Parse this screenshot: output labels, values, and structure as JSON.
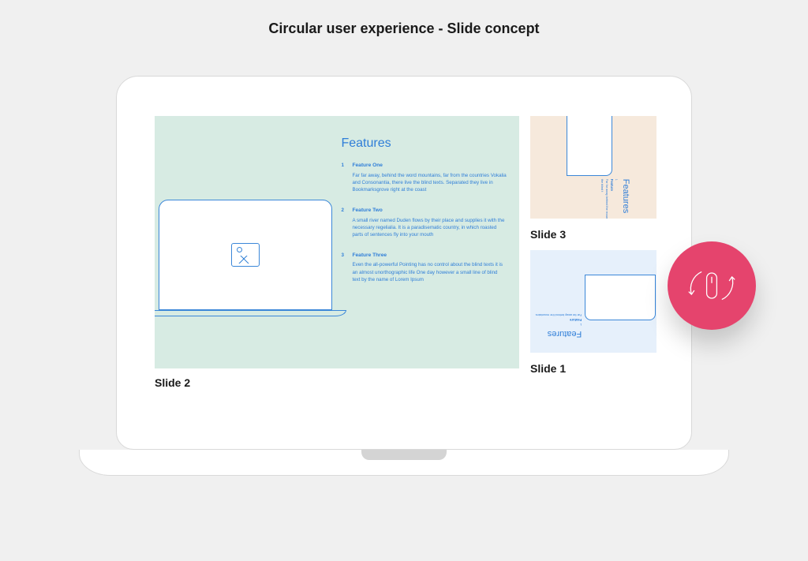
{
  "page_title": "Circular user experience - Slide concept",
  "colors": {
    "accent_pink": "#e5446d",
    "slide2_bg": "#d7ebe3",
    "slide3_bg": "#f6e9dc",
    "slide1_bg": "#e6f0fb",
    "stroke_blue": "#3b87d8",
    "text_blue": "#2f7ed8"
  },
  "main_slide": {
    "label": "Slide 2",
    "heading": "Features",
    "items": [
      {
        "num": "1",
        "title": "Feature One",
        "body": "Far far away, behind the word mountains, far from the countries Vokalia and Consonantia, there live the blind texts. Separated they live in Bookmarksgrove right at the coast"
      },
      {
        "num": "2",
        "title": "Feature Two",
        "body": "A small river named Duden flows by their place and supplies it with the necessary regelialia. It is a paradisematic country, in which roasted parts of sentences fly into your mouth"
      },
      {
        "num": "3",
        "title": "Feature Three",
        "body": "Even the all-powerful Pointing has no control about the blind texts it is an almost unorthographic life One day however a small line of blind text by the name of Lorem Ipsum"
      }
    ]
  },
  "thumbnails": [
    {
      "label": "Slide 3",
      "heading": "Features",
      "item_num": "1",
      "item_title": "Feature",
      "item_body": "Far far away behind the mountains the blind t"
    },
    {
      "label": "Slide 1",
      "heading": "Features",
      "item_num": "1",
      "item_title": "Feature",
      "item_body": "Far far away behind the mountains"
    }
  ],
  "icons": {
    "rotate_mouse": "rotate-mouse-icon",
    "image_placeholder": "image-placeholder-icon"
  }
}
